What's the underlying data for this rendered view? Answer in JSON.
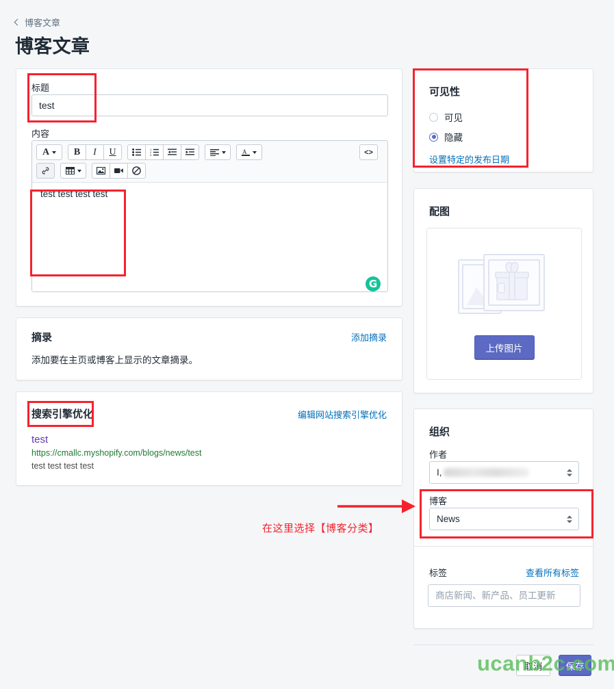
{
  "header": {
    "breadcrumb": "博客文章",
    "title": "博客文章"
  },
  "main": {
    "title_label": "标题",
    "title_value": "test",
    "content_label": "内容",
    "content_value": "test test test test",
    "toolbar": {
      "font_label": "A",
      "bold_label": "B",
      "italic_label": "I",
      "underline_label": "U",
      "bullet_list_icon": "bulleted-list-icon",
      "numbered_list_icon": "numbered-list-icon",
      "outdent_icon": "outdent-icon",
      "indent_icon": "indent-icon",
      "align_icon": "align-left-icon",
      "text_color_label": "A",
      "code_label": "<>",
      "link_icon": "link-icon",
      "table_icon": "table-icon",
      "image_icon": "insert-image-icon",
      "video_icon": "insert-video-icon",
      "clear_format_icon": "clear-formatting-icon"
    },
    "grammarly_label": "G"
  },
  "excerpt": {
    "title": "摘录",
    "add_link": "添加摘录",
    "description": "添加要在主页或博客上显示的文章摘录。"
  },
  "seo": {
    "title": "搜索引擎优化",
    "edit_link": "编辑网站搜索引擎优化",
    "preview_title": "test",
    "preview_url": "https://cmallc.myshopify.com/blogs/news/test",
    "preview_description": "test test test test"
  },
  "visibility": {
    "title": "可见性",
    "option_visible": "可见",
    "option_hidden": "隐藏",
    "selected": "隐藏",
    "schedule_link": "设置特定的发布日期"
  },
  "featured_image": {
    "title": "配图",
    "upload_button": "上传图片",
    "placeholder_icon": "photos-placeholder-icon"
  },
  "organization": {
    "title": "组织",
    "author_label": "作者",
    "author_value": "",
    "blog_label": "博客",
    "blog_value": "News",
    "tags_label": "标签",
    "tags_link": "查看所有标签",
    "tags_placeholder": "商店新闻、新产品、员工更新",
    "tags_value": ""
  },
  "footer": {
    "cancel_label": "取消",
    "save_label": "保存"
  },
  "annotations": {
    "note": "在这里选择【博客分类】",
    "color": "#f5222d"
  },
  "watermark": {
    "text": "ucanb2c.com",
    "color": "#5bbf5b"
  }
}
